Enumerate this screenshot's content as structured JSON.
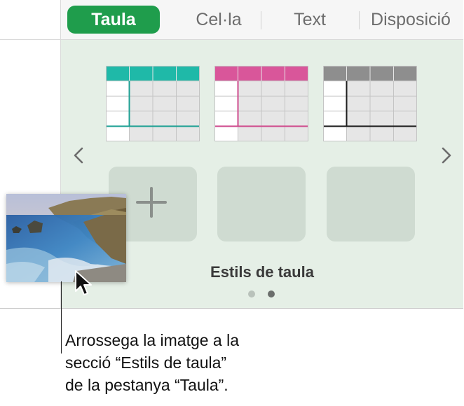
{
  "tabs": [
    {
      "label": "Taula",
      "active": true
    },
    {
      "label": "Cel·la",
      "active": false
    },
    {
      "label": "Text",
      "active": false
    },
    {
      "label": "Disposició",
      "active": false
    }
  ],
  "panel": {
    "section_label": "Estils de taula",
    "table_styles": [
      {
        "accent": "#1fb9a8",
        "line": "#1fa194"
      },
      {
        "accent": "#d9569a",
        "line": "#cf4c8e"
      },
      {
        "accent": "#8e8e8e",
        "line": "#1e1e1e"
      }
    ],
    "empty_slots": 3,
    "add_slot_icon": "plus-icon",
    "page_count": 2,
    "current_page": 2,
    "prev_icon": "chevron-left-icon",
    "next_icon": "chevron-right-icon"
  },
  "colors": {
    "tab_active": "#1f9d4c",
    "panel_bg": "#e5efe6",
    "slot_bg": "#cfdbd1"
  },
  "caption": {
    "line1": "Arrossega la imatge a la",
    "line2": "secció “Estils de taula”",
    "line3": "de la pestanya “Taula”."
  }
}
